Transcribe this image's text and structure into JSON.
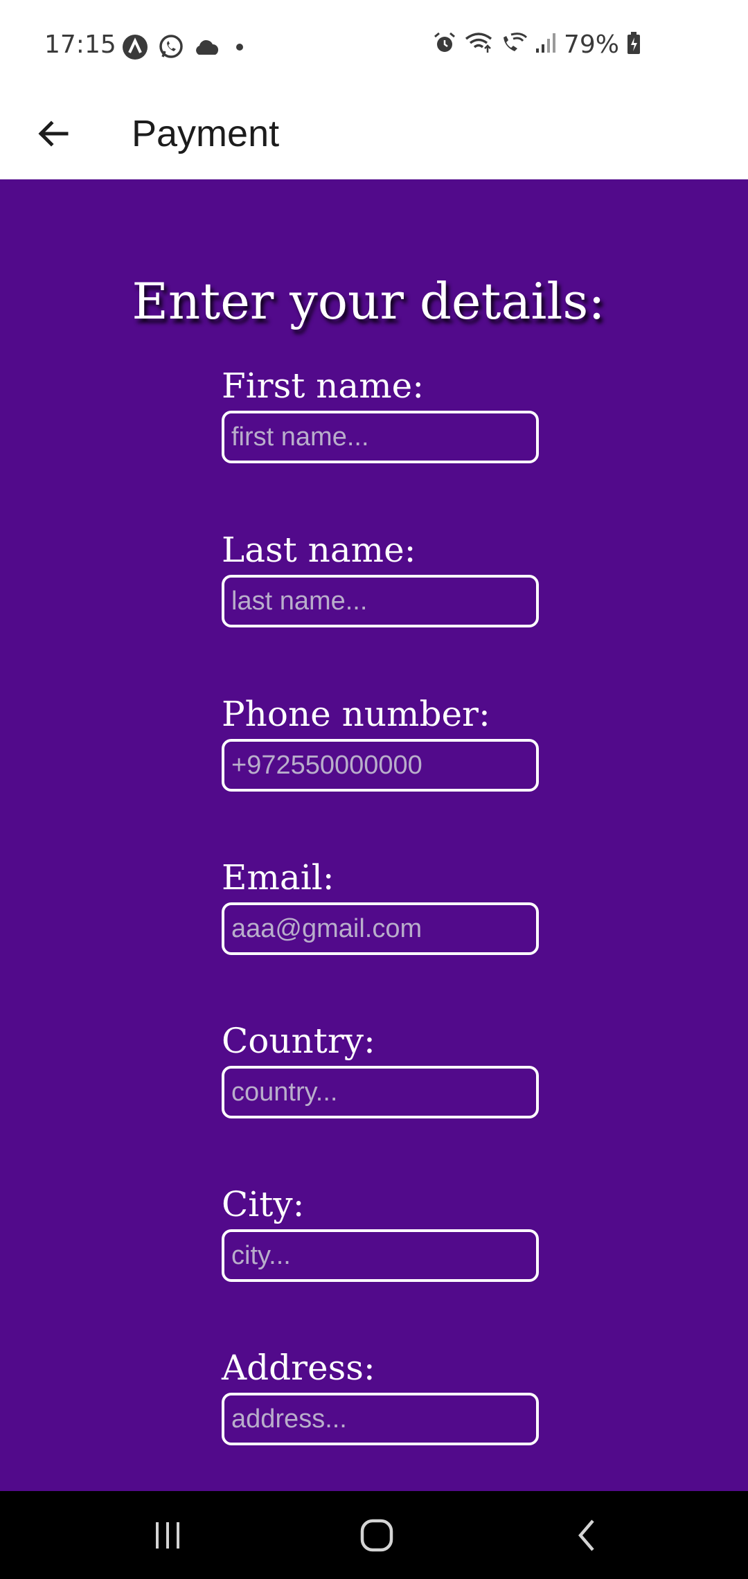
{
  "status_bar": {
    "time": "17:15",
    "battery": "79%",
    "left_icons": [
      "app-a-icon",
      "whatsapp-icon",
      "cloud-icon",
      "dot-icon"
    ],
    "right_icons": [
      "alarm-icon",
      "wifi-icon",
      "wifi-call-icon",
      "signal-icon",
      "battery-icon"
    ]
  },
  "app_bar": {
    "title": "Payment",
    "back_icon": "arrow-left-icon"
  },
  "form": {
    "heading": "Enter your details:",
    "fields": [
      {
        "label": "First name:",
        "placeholder": "first name...",
        "value": ""
      },
      {
        "label": "Last name:",
        "placeholder": "last name...",
        "value": ""
      },
      {
        "label": "Phone number:",
        "placeholder": "+972550000000",
        "value": ""
      },
      {
        "label": "Email:",
        "placeholder": "aaa@gmail.com",
        "value": ""
      },
      {
        "label": "Country:",
        "placeholder": "country...",
        "value": ""
      },
      {
        "label": "City:",
        "placeholder": "city...",
        "value": ""
      },
      {
        "label": "Address:",
        "placeholder": "address...",
        "value": ""
      }
    ]
  },
  "nav_bar": {
    "buttons": [
      "recent-apps-icon",
      "home-icon",
      "back-icon"
    ]
  },
  "colors": {
    "background": "#520a8b",
    "bar_background": "#ffffff",
    "nav_background": "#000000",
    "text_light": "#ffffff",
    "placeholder": "#b9aecb"
  }
}
